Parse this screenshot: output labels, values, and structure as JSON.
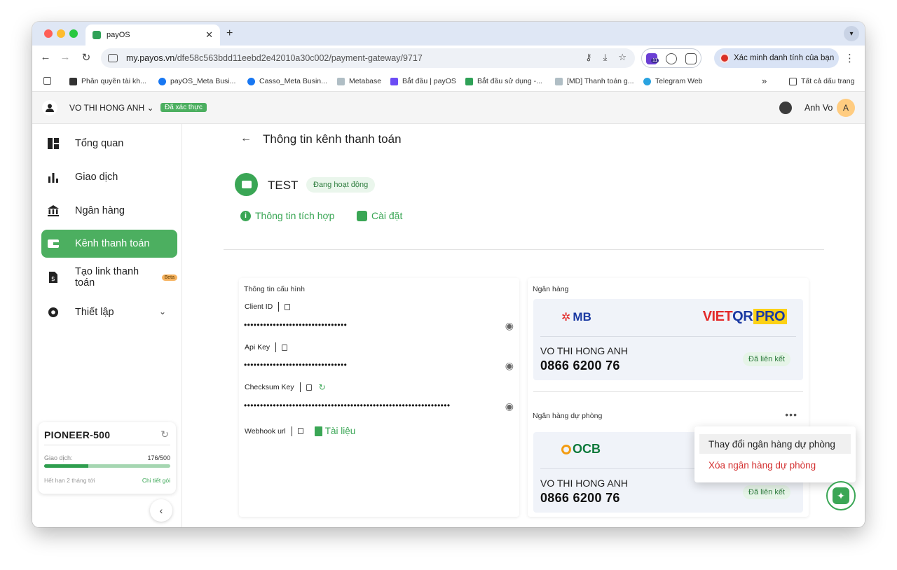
{
  "browser": {
    "tab_title": "payOS",
    "tab_close": "✕",
    "new_tab": "+",
    "url_host": "my.payos.vn",
    "url_path": "/dfe58c563bdd11eebd2e42010a30c002/payment-gateway/9717",
    "verify_label": "Xác minh danh tính của bạn",
    "extension_badge": "11",
    "bookmarks": [
      "Phân quyền tài kh...",
      "payOS_Meta Busi...",
      "Casso_Meta Busin...",
      "Metabase",
      "Bắt đầu | payOS",
      "Bắt đầu sử dụng -...",
      "[MD] Thanh toán g...",
      "Telegram Web"
    ],
    "bookmarks_more": "»",
    "all_bookmarks": "Tất cả dấu trang"
  },
  "header": {
    "user_name": "VO THI HONG ANH",
    "verified_badge": "Đã xác thực",
    "account_name": "Anh Vo",
    "avatar_letter": "A"
  },
  "sidebar": {
    "items": [
      {
        "label": "Tổng quan"
      },
      {
        "label": "Giao dịch"
      },
      {
        "label": "Ngân hàng"
      },
      {
        "label": "Kênh thanh toán"
      },
      {
        "label": "Tạo link thanh toán"
      },
      {
        "label": "Thiết lập"
      }
    ],
    "beta_badge": "Beta",
    "plan": {
      "name": "PIONEER-500",
      "usage_label": "Giao dịch:",
      "usage_count": "176/500",
      "used": 176,
      "limit": 500,
      "expiry": "Hết hạn 2 tháng tới",
      "details_link": "Chi tiết gói"
    }
  },
  "main": {
    "page_title": "Thông tin kênh thanh toán",
    "channel_name": "TEST",
    "channel_status": "Đang hoạt động",
    "tabs": [
      "Thông tin tích hợp",
      "Cài đặt"
    ],
    "config": {
      "section_title": "Thông tin cấu hình",
      "client_id_label": "Client ID",
      "client_id_value": "••••••••••••••••••••••••••••••••",
      "api_key_label": "Api Key",
      "api_key_value": "••••••••••••••••••••••••••••••••",
      "checksum_label": "Checksum Key",
      "checksum_value": "••••••••••••••••••••••••••••••••••••••••••••••••••••••••••••••••",
      "webhook_label": "Webhook url",
      "docs_link": "Tài liệu"
    },
    "bank": {
      "section_title": "Ngân hàng",
      "bank_logo_text": "MB",
      "vietqr_text_a": "VIET",
      "vietqr_text_b": "QR",
      "vietqr_text_c": "PRO",
      "account_name": "VO THI HONG ANH",
      "account_number": "0866 6200 76",
      "status": "Đã liên kết"
    },
    "backup_bank": {
      "section_title": "Ngân hàng dự phòng",
      "bank_logo_text": "OCB",
      "account_name": "VO THI HONG ANH",
      "account_number": "0866 6200 76",
      "status": "Đã liên kết",
      "menu": [
        "Thay đổi ngân hàng dự phòng",
        "Xóa ngân hàng dự phòng"
      ]
    }
  },
  "colors": {
    "accent": "#4caf60",
    "danger": "#d32f2f"
  }
}
